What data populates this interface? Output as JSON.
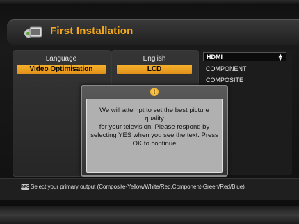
{
  "header": {
    "title": "First Installation"
  },
  "left_column": {
    "items": [
      {
        "label": "Language"
      },
      {
        "label": "Video Optimisation"
      }
    ]
  },
  "mid_column": {
    "items": [
      {
        "label": "English"
      },
      {
        "label": "LCD"
      }
    ]
  },
  "right_column": {
    "selected": "HDMI",
    "options": [
      "COMPONENT",
      "COMPOSITE"
    ]
  },
  "dialog": {
    "icon": "exclamation-icon",
    "text_lines": [
      "We will attempt to set the best picture quality",
      "for your television. Please respond by",
      "selecting YES when you see the text.   Press",
      "OK to continue"
    ]
  },
  "footer": {
    "badge": "INFO",
    "help_text": "Select your primary output (Composite-Yellow/White/Red,Component-Green/Red/Blue)"
  },
  "colors": {
    "accent": "#f4a91c",
    "highlight": "#eaa022"
  }
}
